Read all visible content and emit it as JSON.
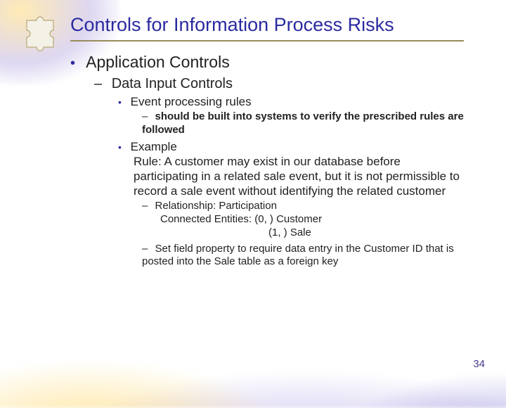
{
  "decor": {
    "puzzle_icon": "puzzle-piece-icon"
  },
  "title": "Controls for Information Process Risks",
  "page_number": "34",
  "bullets": {
    "l1": "Application Controls",
    "l2": "Data Input Controls",
    "l3a": "Event processing rules",
    "l3a_sub": "should be built into systems to verify the prescribed rules are followed",
    "l3b_label": "Example",
    "l3b_body": "Rule: A customer may exist in our database before participating in a related sale event, but it is not permissible to record a sale event without identifying the related customer",
    "l3b_sub1_line1": "Relationship: Participation",
    "l3b_sub1_line2": "Connected Entities: (0, ) Customer",
    "l3b_sub1_line3": "(1, ) Sale",
    "l3b_sub2": "Set field property to require data entry in the Customer ID that is posted into the Sale table as a foreign key"
  }
}
